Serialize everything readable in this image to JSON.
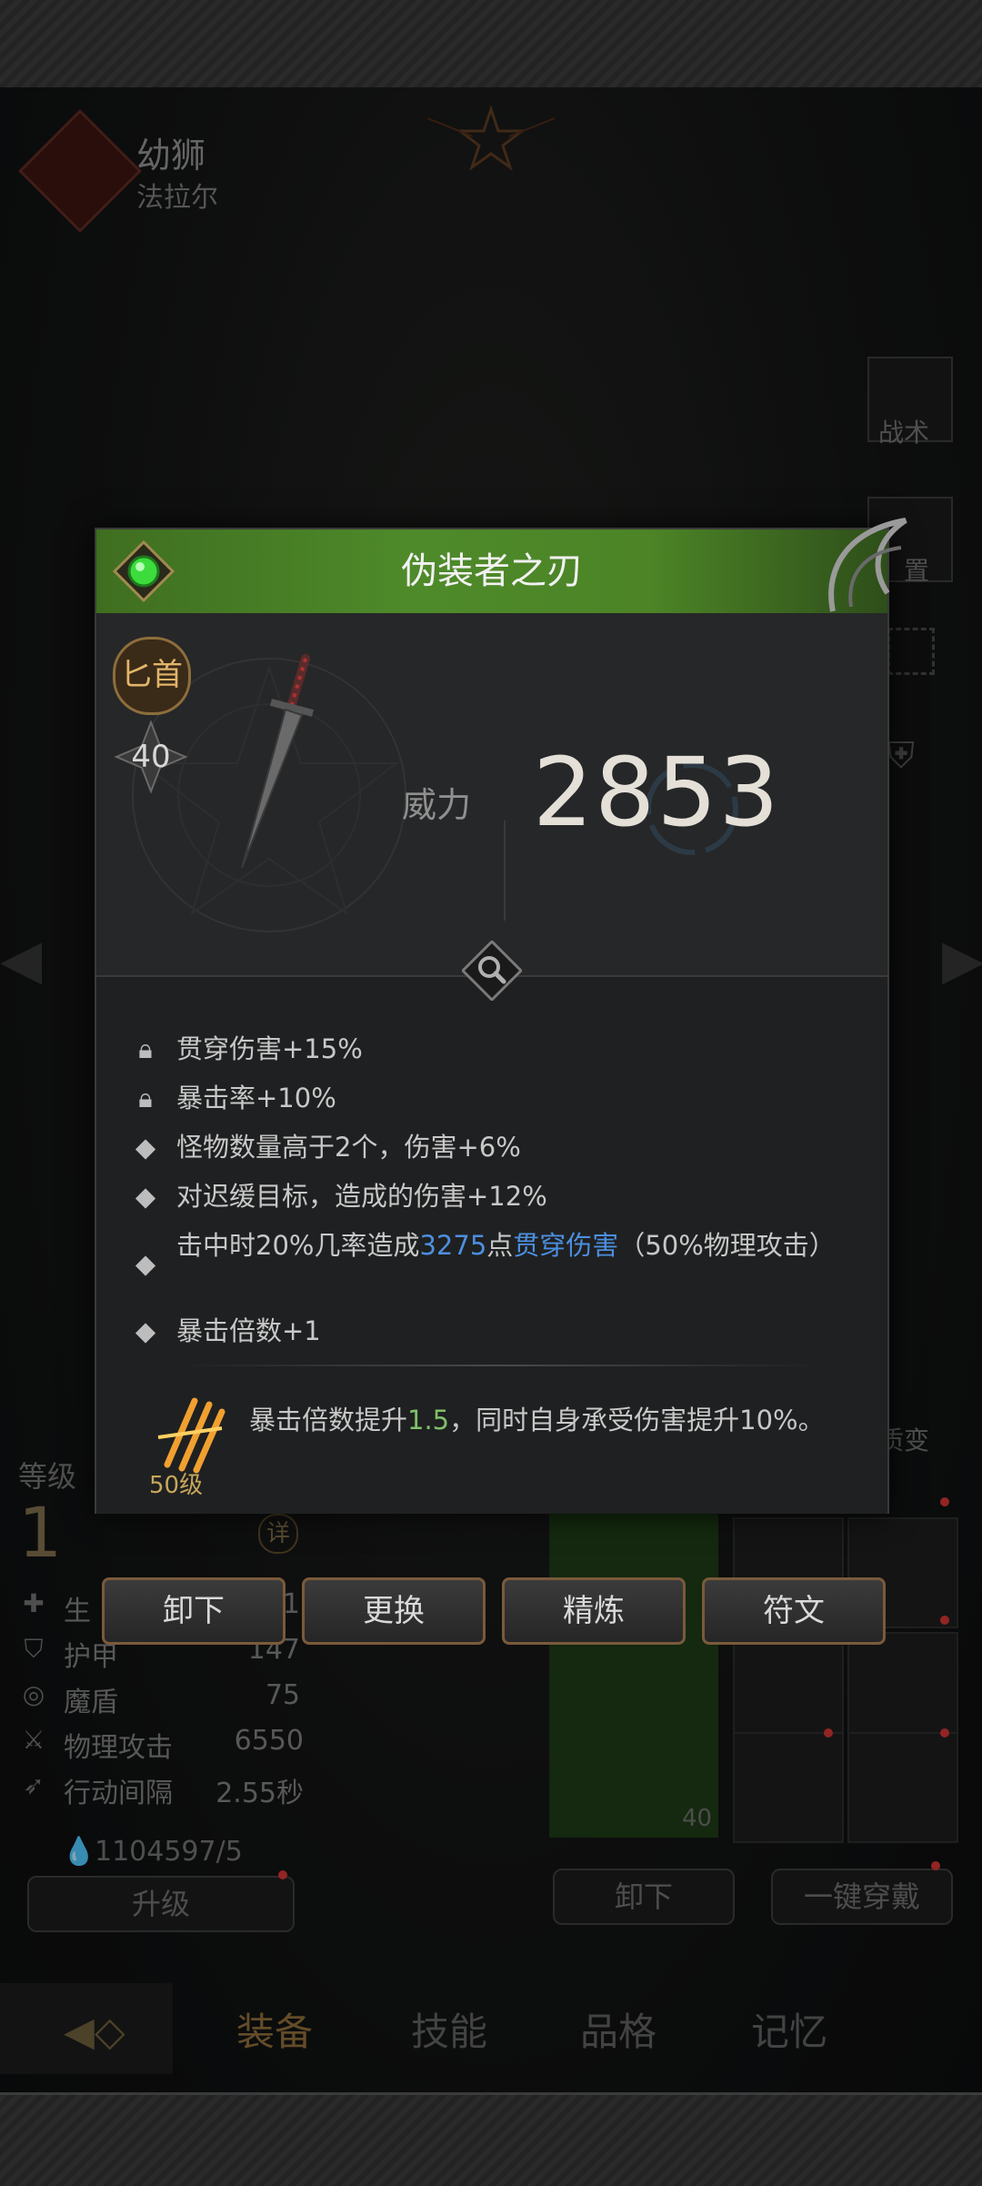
{
  "character": {
    "title": "幼狮",
    "subtitle": "法拉尔"
  },
  "side_menu": [
    {
      "label": "战术"
    },
    {
      "label": "置"
    }
  ],
  "side_evolve": "质变",
  "stats": {
    "level_label": "等级",
    "level_value": "1",
    "detail_label": "详",
    "rows": [
      {
        "label": "生",
        "value": "1"
      },
      {
        "label": "护甲",
        "value": "147"
      },
      {
        "label": "魔盾",
        "value": "75"
      },
      {
        "label": "物理攻击",
        "value": "6550"
      },
      {
        "label": "行动间隔",
        "value": "2.55秒"
      }
    ],
    "currency": "1104597/5",
    "upgrade_label": "升级"
  },
  "equip": {
    "slot_level": "40",
    "unequip_label": "卸下",
    "equip_all_label": "一键穿戴"
  },
  "bottom_tabs": [
    {
      "label": "装备",
      "active": true
    },
    {
      "label": "技能",
      "active": false
    },
    {
      "label": "品格",
      "active": false
    },
    {
      "label": "记忆",
      "active": false
    }
  ],
  "modal": {
    "title": "伪装者之刃",
    "weapon_type": "匕首",
    "weapon_level": "40",
    "power_label": "威力",
    "power_value": "2853",
    "affixes": [
      {
        "icon": "lock-icon",
        "text": "贯穿伤害+15%"
      },
      {
        "icon": "lock-icon",
        "text": "暴击率+10%"
      },
      {
        "icon": "diamond-bullet-icon",
        "text": "怪物数量高于2个，伤害+6%"
      },
      {
        "icon": "diamond-bullet-icon",
        "text": "对迟缓目标，造成的伤害+12%"
      },
      {
        "icon": "diamond-bullet-icon",
        "text_parts": [
          "击中时20%几率造成",
          "3275",
          "点",
          "贯穿伤害",
          "（50%物理攻击）"
        ]
      },
      {
        "icon": "diamond-bullet-icon",
        "text": "暴击倍数+1"
      }
    ],
    "passive": {
      "level": "50级",
      "text_parts": [
        "暴击倍数提升",
        "1.5",
        "，同时自身承受伤害提升10%。"
      ]
    },
    "buttons": {
      "unequip": "卸下",
      "replace": "更换",
      "refine": "精炼",
      "rune": "符文"
    }
  },
  "colors": {
    "header_green": "#4e8a2a",
    "highlight_blue": "#4c8fe0",
    "highlight_green": "#7fc06a",
    "type_gold": "#e2b56a",
    "button_border": "#7a5a3a"
  }
}
